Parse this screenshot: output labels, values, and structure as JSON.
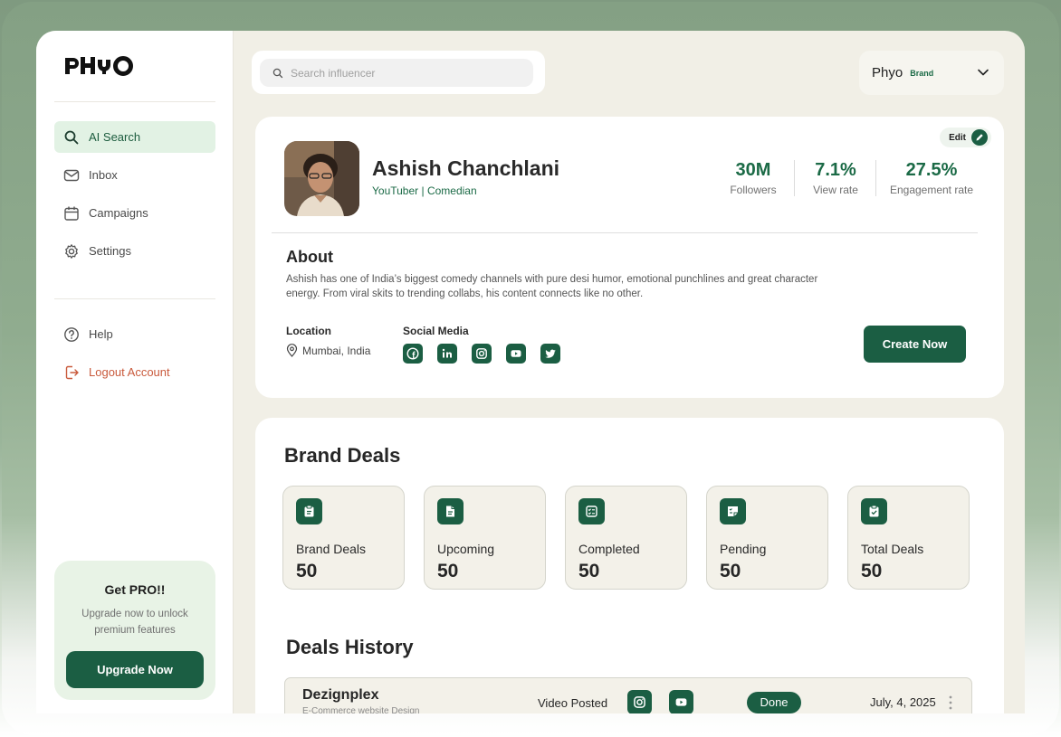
{
  "brand": {
    "logo_text": "PhYO"
  },
  "search": {
    "placeholder": "Search influencer"
  },
  "account": {
    "name": "Phyo",
    "role": "Brand"
  },
  "sidebar": {
    "items": [
      {
        "label": "AI Search",
        "icon": "search-icon",
        "active": true
      },
      {
        "label": "Inbox",
        "icon": "mail-icon"
      },
      {
        "label": "Campaigns",
        "icon": "calendar-icon"
      },
      {
        "label": "Settings",
        "icon": "gear-icon"
      }
    ],
    "bottom_items": [
      {
        "label": "Help",
        "icon": "help-icon"
      },
      {
        "label": "Logout Account",
        "icon": "logout-icon"
      }
    ],
    "promo": {
      "title": "Get PRO!!",
      "description": "Upgrade now to unlock premium features",
      "button": "Upgrade Now"
    }
  },
  "profile": {
    "edit_label": "Edit",
    "name": "Ashish Chanchlani",
    "tagline": "YouTuber | Comedian",
    "stats": [
      {
        "value": "30M",
        "label": "Followers"
      },
      {
        "value": "7.1%",
        "label": "View rate"
      },
      {
        "value": "27.5%",
        "label": "Engagement rate"
      }
    ],
    "about_title": "About",
    "about_text": "Ashish has one of India’s biggest comedy channels with pure desi humor, emotional punchlines and great character energy. From viral skits to trending collabs, his content connects like no other.",
    "location_label": "Location",
    "location": "Mumbai, India",
    "social_label": "Social Media",
    "socials": [
      "facebook-icon",
      "linkedin-icon",
      "instagram-icon",
      "youtube-icon",
      "twitter-icon"
    ],
    "cta": "Create Now"
  },
  "deals": {
    "title": "Brand Deals",
    "tiles": [
      {
        "label": "Brand Deals",
        "value": "50",
        "icon": "clipboard-icon"
      },
      {
        "label": "Upcoming",
        "value": "50",
        "icon": "document-icon"
      },
      {
        "label": "Completed",
        "value": "50",
        "icon": "checklist-icon"
      },
      {
        "label": "Pending",
        "value": "50",
        "icon": "pending-icon"
      },
      {
        "label": "Total Deals",
        "value": "50",
        "icon": "clipboard-check-icon"
      }
    ]
  },
  "history": {
    "title": "Deals History",
    "rows": [
      {
        "brand": "Dezignplex",
        "subtitle": "E-Commerce website Design",
        "action": "Video Posted",
        "platforms": [
          "instagram-icon",
          "youtube-icon"
        ],
        "status": "Done",
        "date": "July, 4, 2025"
      }
    ]
  },
  "colors": {
    "accent": "#1b5e43",
    "accent_light": "#e2f2e4",
    "logout": "#c95a3c",
    "background": "#f1efe6"
  }
}
